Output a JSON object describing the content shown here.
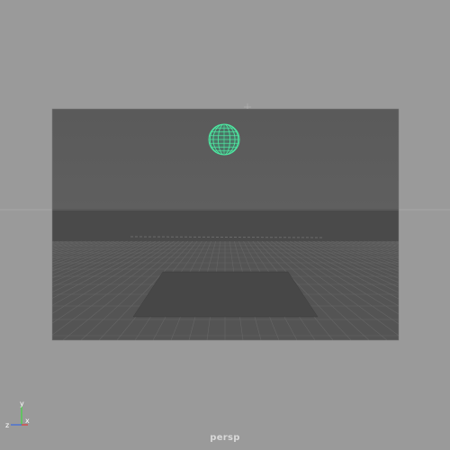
{
  "viewport": {
    "camera_name": "persp",
    "background_color": "#9a9a9a",
    "scene_backdrop_color": "#5a5a5a",
    "ground_plane_color": "#4b4b4b",
    "plane_object_color": "#444444",
    "sphere_wireframe_color": "#4ee6a0",
    "sphere_icon": "sphere-wireframe-icon",
    "axis_gizmo": {
      "x_label": "x",
      "y_label": "y",
      "z_label": "z",
      "x_color": "#e03a3a",
      "y_color": "#3fdc3f",
      "z_color": "#3a6ae0"
    }
  }
}
